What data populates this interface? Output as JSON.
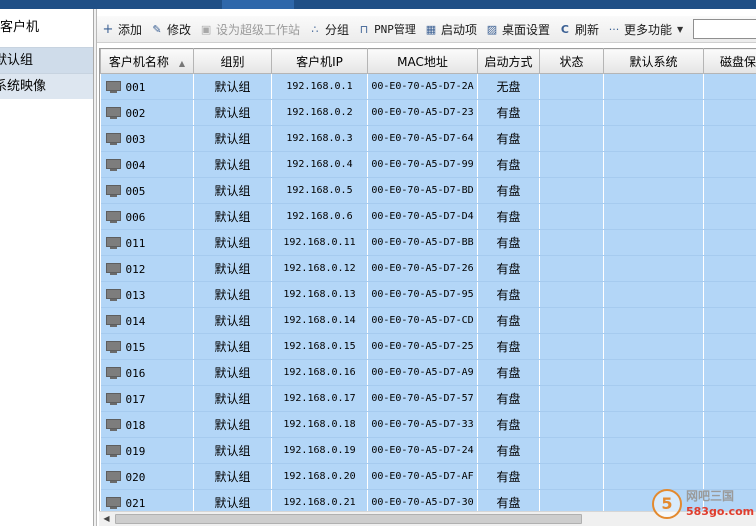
{
  "sidebar": {
    "root_label": "客户机",
    "items": [
      {
        "label": "默认组"
      },
      {
        "label": "系统映像"
      }
    ]
  },
  "toolbar": {
    "buttons": [
      {
        "icon": "plus-icon",
        "label": "添加",
        "enabled": true
      },
      {
        "icon": "pencil-icon",
        "label": "修改",
        "enabled": true
      },
      {
        "icon": "workstation-icon",
        "label": "设为超级工作站",
        "enabled": false
      },
      {
        "icon": "group-icon",
        "label": "分组",
        "enabled": true
      },
      {
        "icon": "plug-icon",
        "label": "PNP管理",
        "enabled": true
      },
      {
        "icon": "grid-icon",
        "label": "启动项",
        "enabled": true
      },
      {
        "icon": "image-icon",
        "label": "桌面设置",
        "enabled": true
      },
      {
        "icon": "refresh-icon",
        "label": "刷新",
        "enabled": true
      },
      {
        "icon": "ellipsis-icon",
        "label": "更多功能",
        "enabled": true
      }
    ],
    "search_value": ""
  },
  "table": {
    "columns": [
      "客户机名称",
      "组别",
      "客户机IP",
      "MAC地址",
      "启动方式",
      "状态",
      "默认系统",
      "磁盘保"
    ],
    "rows": [
      {
        "name": "001",
        "group": "默认组",
        "ip": "192.168.0.1",
        "mac": "00-E0-70-A5-D7-2A",
        "boot": "无盘",
        "status": "",
        "default_os": "",
        "disk": ""
      },
      {
        "name": "002",
        "group": "默认组",
        "ip": "192.168.0.2",
        "mac": "00-E0-70-A5-D7-23",
        "boot": "有盘",
        "status": "",
        "default_os": "",
        "disk": ""
      },
      {
        "name": "003",
        "group": "默认组",
        "ip": "192.168.0.3",
        "mac": "00-E0-70-A5-D7-64",
        "boot": "有盘",
        "status": "",
        "default_os": "",
        "disk": ""
      },
      {
        "name": "004",
        "group": "默认组",
        "ip": "192.168.0.4",
        "mac": "00-E0-70-A5-D7-99",
        "boot": "有盘",
        "status": "",
        "default_os": "",
        "disk": ""
      },
      {
        "name": "005",
        "group": "默认组",
        "ip": "192.168.0.5",
        "mac": "00-E0-70-A5-D7-BD",
        "boot": "有盘",
        "status": "",
        "default_os": "",
        "disk": ""
      },
      {
        "name": "006",
        "group": "默认组",
        "ip": "192.168.0.6",
        "mac": "00-E0-70-A5-D7-D4",
        "boot": "有盘",
        "status": "",
        "default_os": "",
        "disk": ""
      },
      {
        "name": "011",
        "group": "默认组",
        "ip": "192.168.0.11",
        "mac": "00-E0-70-A5-D7-BB",
        "boot": "有盘",
        "status": "",
        "default_os": "",
        "disk": ""
      },
      {
        "name": "012",
        "group": "默认组",
        "ip": "192.168.0.12",
        "mac": "00-E0-70-A5-D7-26",
        "boot": "有盘",
        "status": "",
        "default_os": "",
        "disk": ""
      },
      {
        "name": "013",
        "group": "默认组",
        "ip": "192.168.0.13",
        "mac": "00-E0-70-A5-D7-95",
        "boot": "有盘",
        "status": "",
        "default_os": "",
        "disk": ""
      },
      {
        "name": "014",
        "group": "默认组",
        "ip": "192.168.0.14",
        "mac": "00-E0-70-A5-D7-CD",
        "boot": "有盘",
        "status": "",
        "default_os": "",
        "disk": ""
      },
      {
        "name": "015",
        "group": "默认组",
        "ip": "192.168.0.15",
        "mac": "00-E0-70-A5-D7-25",
        "boot": "有盘",
        "status": "",
        "default_os": "",
        "disk": ""
      },
      {
        "name": "016",
        "group": "默认组",
        "ip": "192.168.0.16",
        "mac": "00-E0-70-A5-D7-A9",
        "boot": "有盘",
        "status": "",
        "default_os": "",
        "disk": ""
      },
      {
        "name": "017",
        "group": "默认组",
        "ip": "192.168.0.17",
        "mac": "00-E0-70-A5-D7-57",
        "boot": "有盘",
        "status": "",
        "default_os": "",
        "disk": ""
      },
      {
        "name": "018",
        "group": "默认组",
        "ip": "192.168.0.18",
        "mac": "00-E0-70-A5-D7-33",
        "boot": "有盘",
        "status": "",
        "default_os": "",
        "disk": ""
      },
      {
        "name": "019",
        "group": "默认组",
        "ip": "192.168.0.19",
        "mac": "00-E0-70-A5-D7-24",
        "boot": "有盘",
        "status": "",
        "default_os": "",
        "disk": ""
      },
      {
        "name": "020",
        "group": "默认组",
        "ip": "192.168.0.20",
        "mac": "00-E0-70-A5-D7-AF",
        "boot": "有盘",
        "status": "",
        "default_os": "",
        "disk": ""
      },
      {
        "name": "021",
        "group": "默认组",
        "ip": "192.168.0.21",
        "mac": "00-E0-70-A5-D7-30",
        "boot": "有盘",
        "status": "",
        "default_os": "",
        "disk": ""
      }
    ]
  },
  "watermark": {
    "badge": "5",
    "line1": "网吧三国",
    "line2": "583go.com"
  },
  "colors": {
    "row_selected": "#b3d6f7",
    "title_band": "#1f4f86"
  }
}
